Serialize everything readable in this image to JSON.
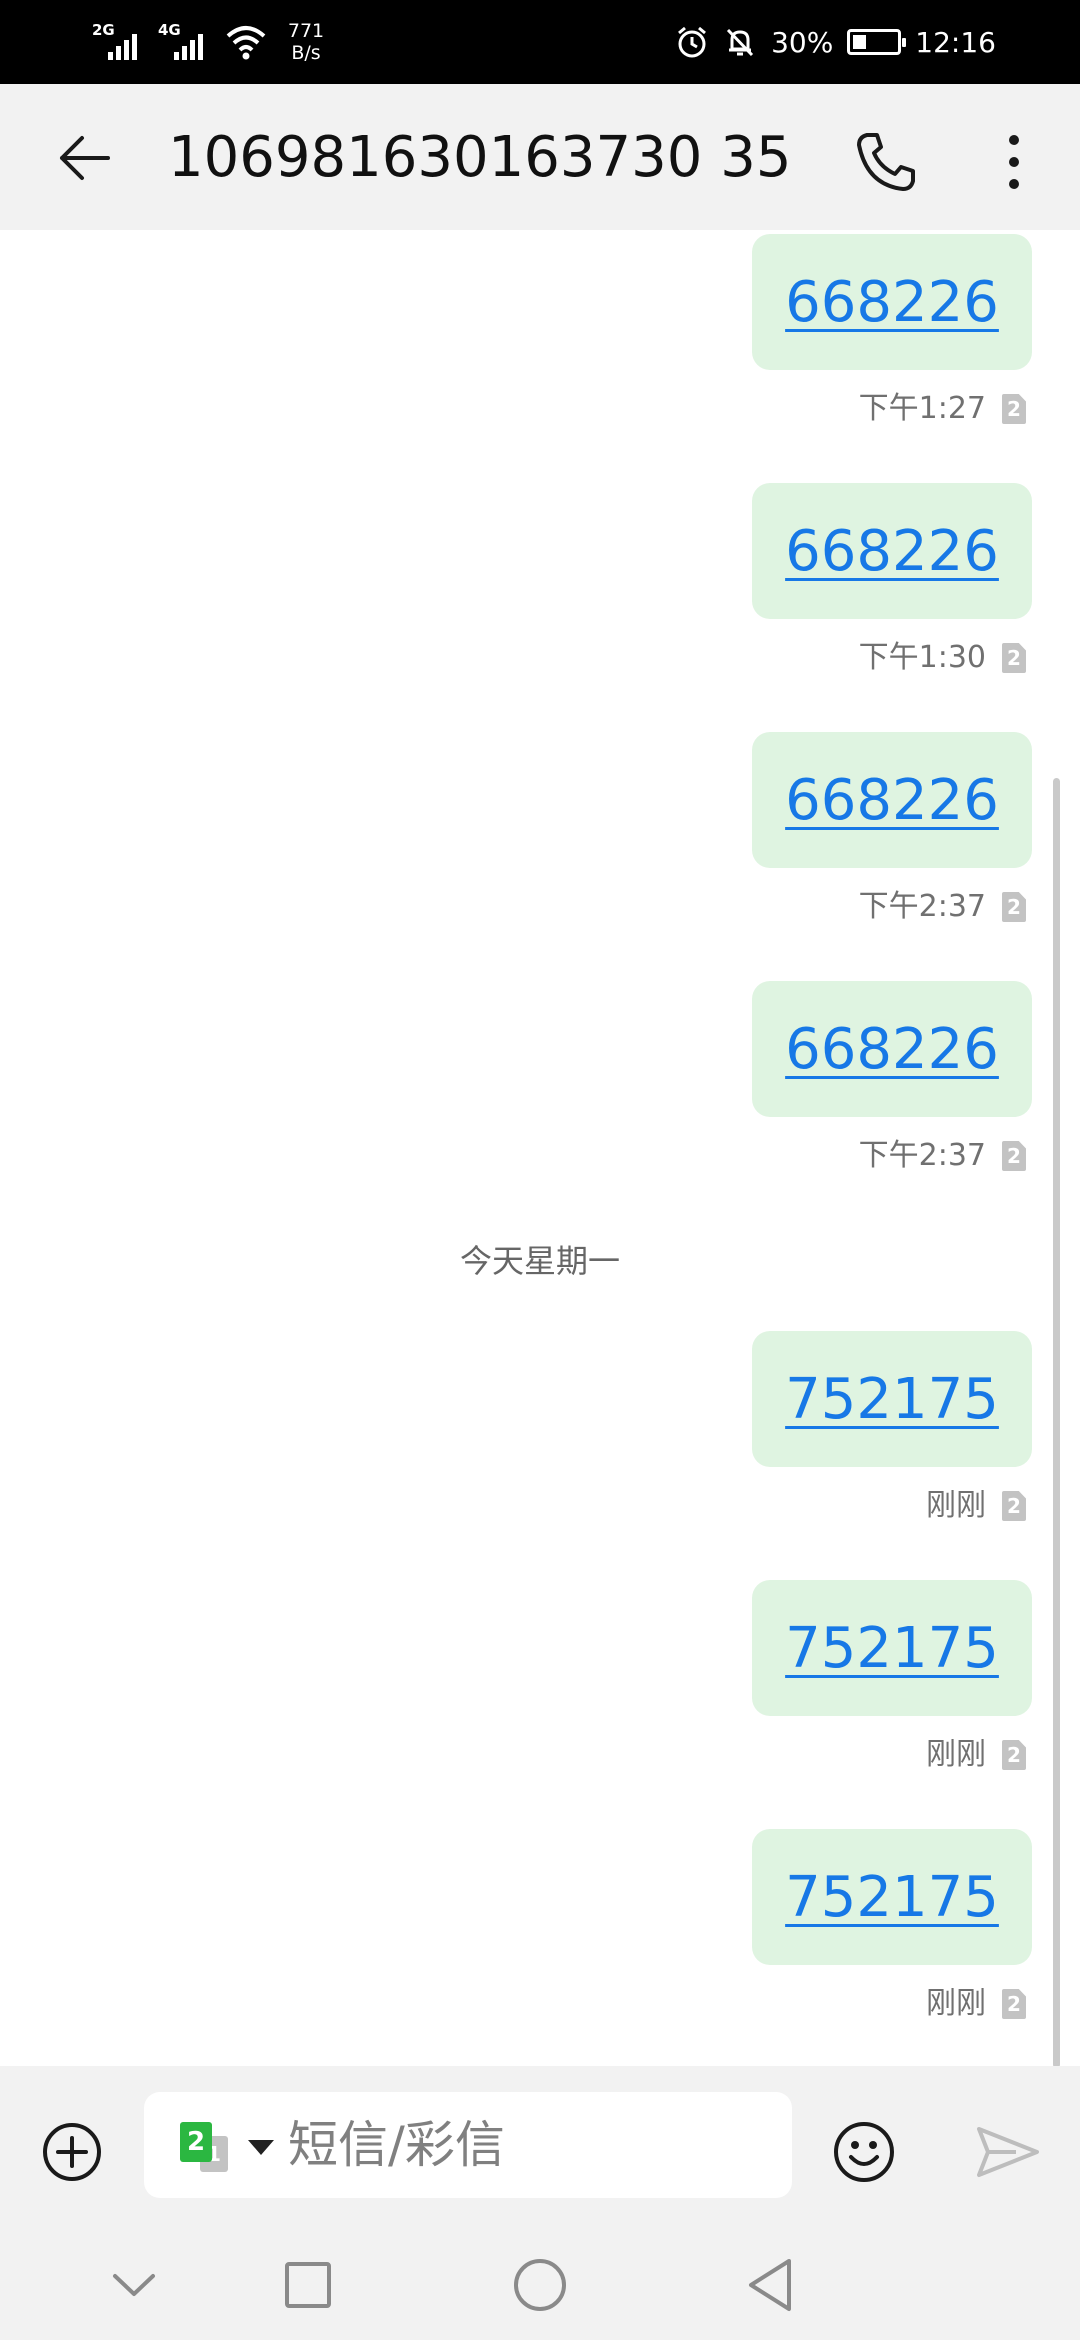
{
  "status_bar": {
    "sim1_network": "2G",
    "sim2_network": "4G",
    "net_speed_value": "771",
    "net_speed_unit": "B/s",
    "battery_percent": "30%",
    "time": "12:16",
    "battery_level": 0.3
  },
  "header": {
    "title": "106981630163730 35"
  },
  "messages": [
    {
      "text": "668226",
      "time": "下午1:27",
      "sim": "2"
    },
    {
      "text": "668226",
      "time": "下午1:30",
      "sim": "2"
    },
    {
      "text": "668226",
      "time": "下午2:37",
      "sim": "2"
    },
    {
      "text": "668226",
      "time": "下午2:37",
      "sim": "2"
    },
    {
      "text": "752175",
      "time": "刚刚",
      "sim": "2"
    },
    {
      "text": "752175",
      "time": "刚刚",
      "sim": "2"
    },
    {
      "text": "752175",
      "time": "刚刚",
      "sim": "2"
    }
  ],
  "day_separator": "今天星期一",
  "composer": {
    "sim_primary": "2",
    "sim_secondary": "1",
    "placeholder": "短信/彩信"
  },
  "colors": {
    "bubble_bg": "#dff4e1",
    "link": "#1778e6",
    "sim_green": "#2bb741"
  }
}
